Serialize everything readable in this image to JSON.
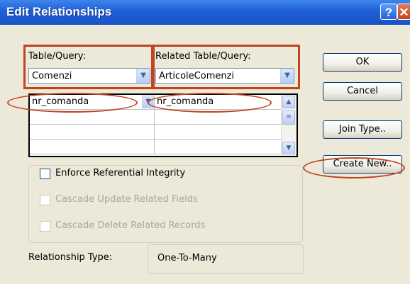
{
  "window": {
    "title": "Edit Relationships",
    "help_glyph": "?",
    "close_glyph": "✕"
  },
  "table_query": {
    "label": "Table/Query:",
    "value": "Comenzi"
  },
  "related_table_query": {
    "label": "Related Table/Query:",
    "value": "ArticoleComenzi"
  },
  "fields_grid": {
    "rows": [
      {
        "left": "nr_comanda",
        "right": "nr_comanda"
      },
      {
        "left": "",
        "right": ""
      },
      {
        "left": "",
        "right": ""
      },
      {
        "left": "",
        "right": ""
      }
    ]
  },
  "buttons": {
    "ok": "OK",
    "cancel": "Cancel",
    "join_type": "Join Type..",
    "create_new": "Create New.."
  },
  "options": {
    "enforce_integrity": {
      "label": "Enforce Referential Integrity",
      "checked": false,
      "enabled": true
    },
    "cascade_update": {
      "label": "Cascade Update Related Fields",
      "checked": false,
      "enabled": false
    },
    "cascade_delete": {
      "label": "Cascade Delete Related Records",
      "checked": false,
      "enabled": false
    }
  },
  "relationship_type": {
    "label": "Relationship Type:",
    "value": "One-To-Many"
  },
  "colors": {
    "title_bar": "#1f5fd6",
    "dialog_bg": "#ece9d8",
    "highlight_annotation": "#c1431f"
  },
  "icons": {
    "dropdown": "chevron-down-icon",
    "scroll_up": "arrow-up-icon",
    "scroll_down": "arrow-down-icon"
  }
}
